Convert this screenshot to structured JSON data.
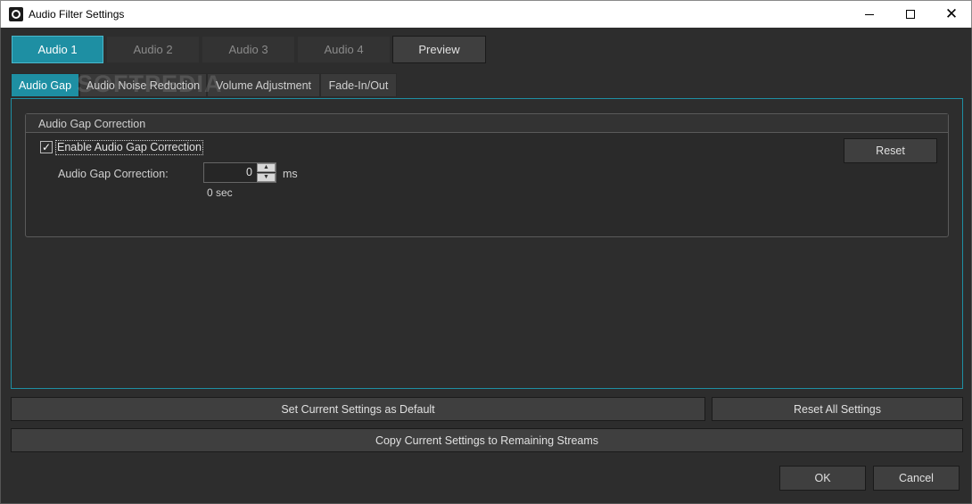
{
  "window": {
    "title": "Audio Filter Settings"
  },
  "stream_tabs": [
    "Audio 1",
    "Audio 2",
    "Audio 3",
    "Audio 4"
  ],
  "preview_label": "Preview",
  "filter_tabs": [
    "Audio Gap",
    "Audio Noise Reduction",
    "Volume Adjustment",
    "Fade-In/Out"
  ],
  "watermark": "SOFTPEDIA",
  "gap_group": {
    "title": "Audio Gap Correction",
    "enable_label": "Enable Audio Gap Correction",
    "enable_checked": true,
    "field_label": "Audio Gap Correction:",
    "value": "0",
    "unit": "ms",
    "seconds_hint": "0 sec",
    "reset_label": "Reset"
  },
  "actions": {
    "set_default": "Set Current Settings as Default",
    "reset_all": "Reset All Settings",
    "copy_streams": "Copy Current Settings to Remaining Streams",
    "ok": "OK",
    "cancel": "Cancel"
  },
  "colors": {
    "accent": "#1e8fa3",
    "background": "#2d2d2d",
    "button": "#3f3f3f"
  }
}
